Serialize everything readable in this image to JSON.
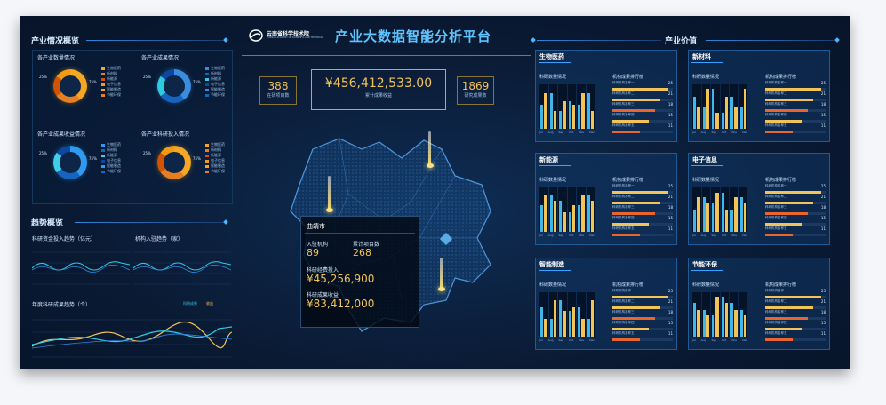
{
  "header": {
    "title": "产业大数据智能分析平台",
    "logo_text": "云南省科学技术院",
    "logo_sub": "YUNNAN ACADEMY OF SCIENTIFIC AND TECHNICAL"
  },
  "left": {
    "section1_title": "产业情况概览",
    "donuts": [
      {
        "title": "各产业数量情况",
        "pct_a": "75%",
        "pct_b": "25%",
        "colors": [
          "#f5a623",
          "#e67e22",
          "#d35400",
          "#f39c12"
        ]
      },
      {
        "title": "各产业成果情况",
        "pct_a": "75%",
        "pct_b": "25%",
        "colors": [
          "#3a8dde",
          "#1565c0",
          "#2ecbe0",
          "#0d47a1"
        ]
      },
      {
        "title": "各产业成果收益情况",
        "pct_a": "75%",
        "pct_b": "25%",
        "colors": [
          "#2e9bf0",
          "#1565c0",
          "#3fd0e8",
          "#0d47a1"
        ]
      },
      {
        "title": "各产业科研投入情况",
        "pct_a": "75%",
        "pct_b": "25%",
        "colors": [
          "#f5a623",
          "#e67e22",
          "#d35400",
          "#f39c12"
        ]
      }
    ],
    "legend_items": [
      "生物医药",
      "新材料",
      "新能源",
      "电子信息",
      "智能制造",
      "节能环保"
    ],
    "section2_title": "趋势概览",
    "trend1_title": "科研资金投入趋势（亿元）",
    "trend2_title": "机构入驻趋势（家）",
    "trend3_title": "年度科研成果趋势（个）",
    "trend3_legend": [
      "科研成果",
      "收益"
    ]
  },
  "stats": [
    {
      "value": "388",
      "label": "在研项目数"
    },
    {
      "value": "¥456,412,533.00",
      "label": "累计成果收益"
    },
    {
      "value": "1869",
      "label": "研究成果数"
    }
  ],
  "map_tip": {
    "city": "曲靖市",
    "label1": "入驻机构",
    "value1": "89",
    "label2": "累计项目数",
    "value2": "268",
    "label3": "科研经费投入",
    "value3": "¥45,256,900",
    "label4": "科研成果收益",
    "value4": "¥83,412,000"
  },
  "right": {
    "section_title": "产业价值",
    "panels": [
      {
        "name": "生物医药"
      },
      {
        "name": "新材料"
      },
      {
        "name": "新能源"
      },
      {
        "name": "电子信息"
      },
      {
        "name": "智能制造"
      },
      {
        "name": "节能环保"
      }
    ],
    "sub_left": "科研数量情况",
    "sub_right": "机构成果排行榜",
    "rank_labels": [
      "科研机构名称一",
      "科研机构名称二",
      "科研机构名称三",
      "科研机构名称四",
      "科研机构名称五"
    ],
    "rank_values": [
      "25",
      "21",
      "18",
      "15",
      "11"
    ],
    "months": [
      "Jul",
      "Aug",
      "Sep",
      "Oct",
      "Nov",
      "Dec"
    ]
  },
  "colors": {
    "accent": "#2e86de",
    "gold": "#f3c356",
    "cyan": "#2ecbe0",
    "orange": "#e8662d"
  }
}
